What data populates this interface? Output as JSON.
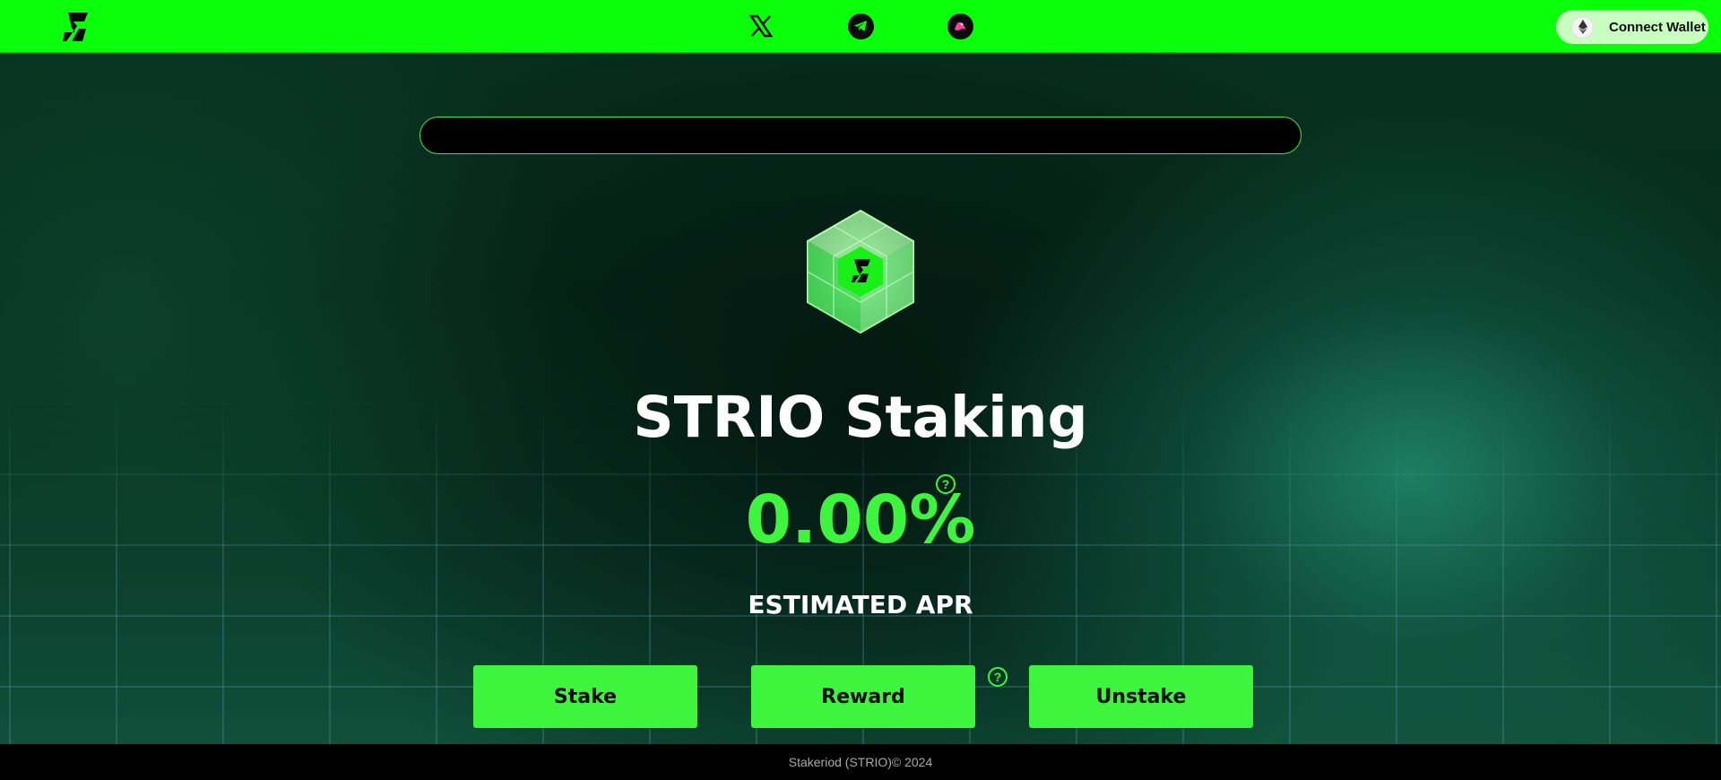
{
  "header": {
    "brand_icon": "strio-logo-icon",
    "social_links": [
      {
        "icon": "x-twitter-icon"
      },
      {
        "icon": "telegram-icon"
      },
      {
        "icon": "community-badge-icon"
      }
    ],
    "connect_wallet": {
      "label": "Connect Wallet",
      "icon": "ethereum-icon"
    }
  },
  "main": {
    "search_placeholder": "",
    "token_logo_icon": "strio-cube-logo",
    "title": "STRIO Staking",
    "apr_value": "0.00%",
    "apr_help": "?",
    "apr_label": "ESTIMATED APR",
    "actions": [
      {
        "label": "Stake"
      },
      {
        "label": "Reward"
      },
      {
        "label": "Unstake"
      }
    ],
    "reward_help": "?"
  },
  "footer": {
    "copyright": "Stakeriod (STRIO)© 2024"
  },
  "colors": {
    "nav_bg": "#0aff0a",
    "accent": "#3ef53e",
    "wallet_btn_bg": "#c8ffc0",
    "footer_bg": "#000000"
  }
}
